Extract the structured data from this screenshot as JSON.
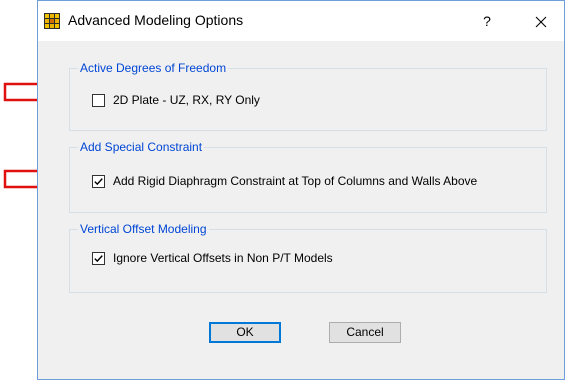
{
  "dialog": {
    "title": "Advanced Modeling Options",
    "help_label": "?",
    "close_label": "✕",
    "icon": "app-grid-icon"
  },
  "groups": [
    {
      "label": "Active Degrees of Freedom",
      "option": {
        "label": "2D Plate - UZ, RX, RY Only",
        "checked": false
      }
    },
    {
      "label": "Add Special Constraint",
      "option": {
        "label": "Add Rigid Diaphragm Constraint at Top of Columns and Walls Above",
        "checked": true
      }
    },
    {
      "label": "Vertical Offset Modeling",
      "option": {
        "label": "Ignore Vertical Offsets in Non P/T Models",
        "checked": true
      }
    }
  ],
  "buttons": {
    "ok_label": "OK",
    "cancel_label": "Cancel"
  },
  "annotations": {
    "arrow_icon": "red-outline-arrow-icon",
    "arrow_color": "#e01010"
  },
  "colors": {
    "group_label": "#0046d5",
    "dialog_bg": "#f0f0f0",
    "window_border": "#6f9fd8"
  }
}
